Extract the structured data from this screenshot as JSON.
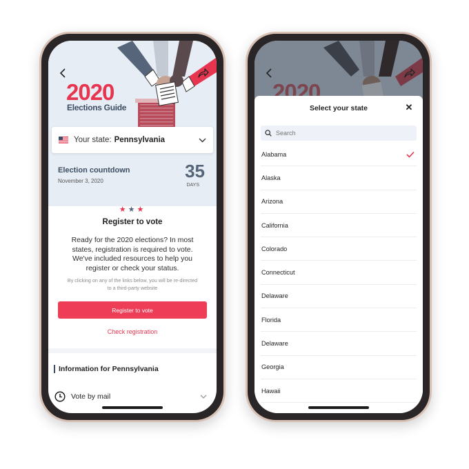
{
  "left_screen": {
    "hero": {
      "year": "2020",
      "subtitle": "Elections Guide"
    },
    "state_selector": {
      "label": "Your state:",
      "value": "Pennsylvania"
    },
    "countdown": {
      "title": "Election countdown",
      "date": "November 3, 2020",
      "days": "35",
      "unit": "DAYS"
    },
    "register": {
      "stars": [
        "★",
        "★",
        "★"
      ],
      "title": "Register to vote",
      "body": "Ready for the 2020 elections? In most states, registration is required to vote. We've included resources to help you register or check your status.",
      "disclaimer": "By clicking on any of the links below, you will be re-directed to a third-party website",
      "button_label": "Register to vote",
      "link_label": "Check registration"
    },
    "info": {
      "heading": "Information for Pennsylvania",
      "item_label": "Vote by mail"
    }
  },
  "right_screen": {
    "hero_year": "2020",
    "sheet_title": "Select your state",
    "close_glyph": "✕",
    "search_placeholder": "Search",
    "selected_state": "Alabama",
    "states": [
      "Alabama",
      "Alaska",
      "Arizona",
      "California",
      "Colorado",
      "Connecticut",
      "Delaware",
      "Florida",
      "Delaware",
      "Georgia",
      "Hawaii"
    ]
  },
  "colors": {
    "accent_red": "#e8354f",
    "navy": "#3d4d63",
    "hero_bg": "#e6edf4"
  },
  "icons": [
    "back-arrow-icon",
    "share-icon",
    "us-flag-icon",
    "chevron-down-icon",
    "clock-icon",
    "search-icon",
    "close-icon",
    "checkmark-icon"
  ]
}
